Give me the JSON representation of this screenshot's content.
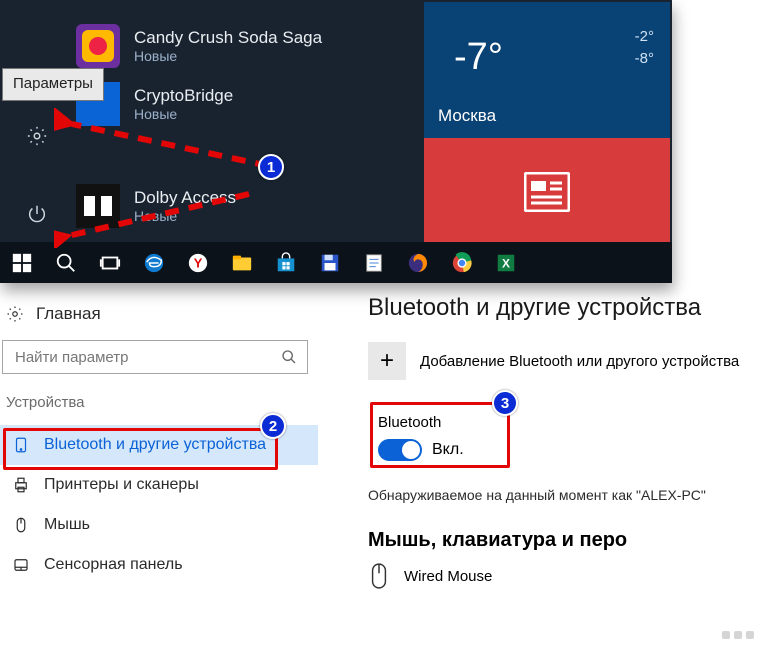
{
  "start": {
    "apps": [
      {
        "title": "Candy Crush Soda Saga",
        "sub": "Новые"
      },
      {
        "title": "CryptoBridge",
        "sub": "Новые"
      },
      {
        "title": "Dolby Access",
        "sub": "Новые"
      }
    ],
    "tooltip": "Параметры",
    "weather": {
      "temp": "-7°",
      "hi": "-2°",
      "lo": "-8°",
      "city": "Москва"
    }
  },
  "settings": {
    "home": "Главная",
    "search_placeholder": "Найти параметр",
    "section": "Устройства",
    "nav": {
      "bluetooth": "Bluetooth и другие устройства",
      "printers": "Принтеры и сканеры",
      "mouse": "Мышь",
      "touchpad": "Сенсорная панель"
    },
    "page_title": "Bluetooth и другие устройства",
    "add_label": "Добавление Bluetooth или другого устройства",
    "bt": {
      "label": "Bluetooth",
      "state": "Вкл."
    },
    "discoverable": "Обнаруживаемое на данный момент как \"ALEX-PC\"",
    "sub_head": "Мышь, клавиатура и перо",
    "device": "Wired Mouse"
  },
  "badges": {
    "b1": "1",
    "b2": "2",
    "b3": "3"
  }
}
